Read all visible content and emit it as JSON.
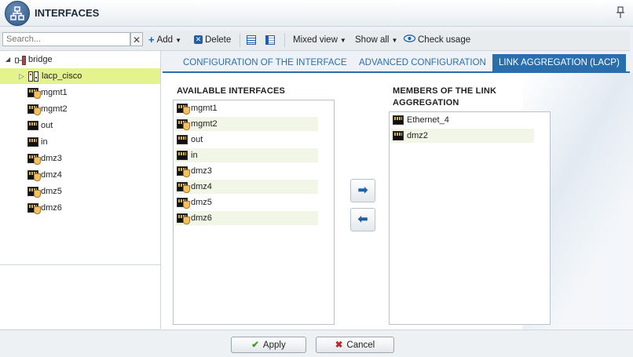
{
  "window": {
    "title": "INTERFACES",
    "pin_icon": "pin-icon"
  },
  "toolbar": {
    "search_placeholder": "Search...",
    "search_value": "",
    "clear_label": "✕",
    "add_label": "Add",
    "delete_label": "Delete",
    "mixed_view_label": "Mixed view",
    "show_all_label": "Show all",
    "check_usage_label": "Check usage"
  },
  "tree": {
    "root": "bridge",
    "selected": "lacp_cisco",
    "items": [
      "mgmt1",
      "mgmt2",
      "out",
      "in",
      "dmz3",
      "dmz4",
      "dmz5",
      "dmz6"
    ]
  },
  "tabs": {
    "config": "CONFIGURATION OF THE INTERFACE",
    "advanced": "ADVANCED CONFIGURATION",
    "lacp": "LINK AGGREGATION (LACP)"
  },
  "available": {
    "heading": "AVAILABLE INTERFACES",
    "items": [
      "mgmt1",
      "mgmt2",
      "out",
      "in",
      "dmz3",
      "dmz4",
      "dmz5",
      "dmz6"
    ]
  },
  "members": {
    "heading_line1": "MEMBERS OF THE LINK",
    "heading_line2": "AGGREGATION",
    "items": [
      "Ethernet_4",
      "dmz2"
    ]
  },
  "buttons": {
    "apply": "Apply",
    "cancel": "Cancel"
  },
  "colors": {
    "accent": "#2a6fad",
    "selected_row": "#e4f38b",
    "alt_row": "#f1f6e6"
  }
}
